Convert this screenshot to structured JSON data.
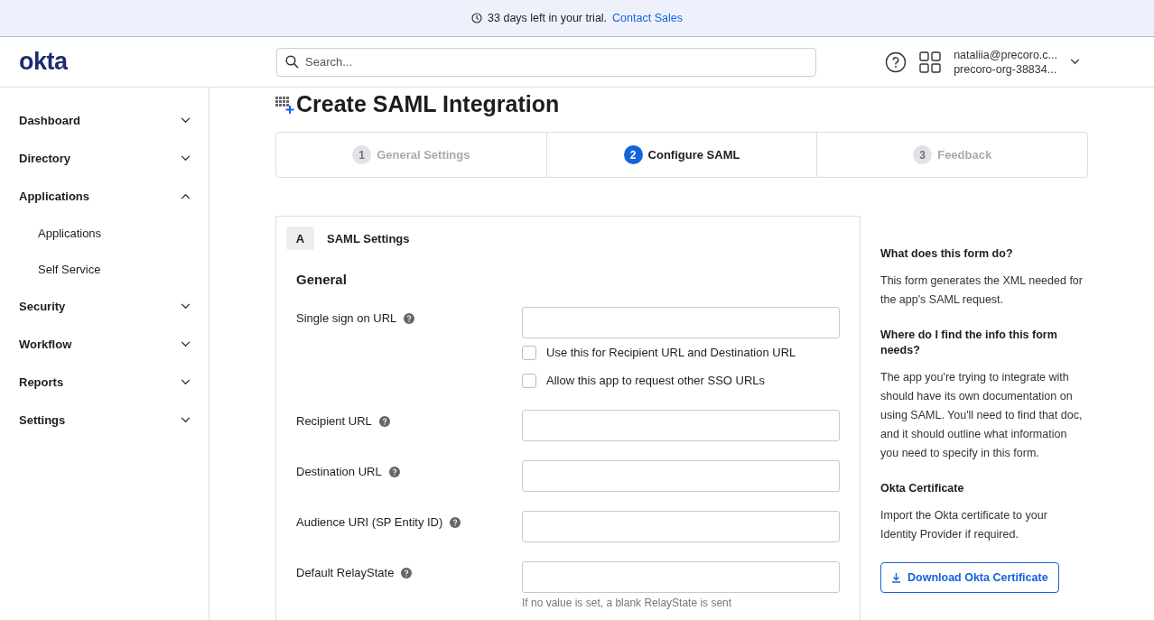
{
  "banner": {
    "text": "33 days left in your trial.",
    "link": "Contact Sales"
  },
  "header": {
    "logo": "okta",
    "search": {
      "placeholder": "Search..."
    },
    "user": {
      "email": "nataliia@precoro.c...",
      "org": "precoro-org-38834..."
    }
  },
  "sidebar": {
    "items": [
      {
        "label": "Dashboard",
        "expanded": false
      },
      {
        "label": "Directory",
        "expanded": false
      },
      {
        "label": "Applications",
        "expanded": true,
        "children": [
          {
            "label": "Applications"
          },
          {
            "label": "Self Service"
          }
        ]
      },
      {
        "label": "Security",
        "expanded": false
      },
      {
        "label": "Workflow",
        "expanded": false
      },
      {
        "label": "Reports",
        "expanded": false
      },
      {
        "label": "Settings",
        "expanded": false
      }
    ]
  },
  "page": {
    "title": "Create SAML Integration"
  },
  "steps": [
    {
      "number": "1",
      "label": "General Settings",
      "selected": false
    },
    {
      "number": "2",
      "label": "Configure SAML",
      "selected": true
    },
    {
      "number": "3",
      "label": "Feedback",
      "selected": false
    }
  ],
  "section": {
    "badge": "A",
    "title": "SAML Settings",
    "group": "General",
    "fields": [
      {
        "label": "Single sign on URL",
        "checkboxes": [
          {
            "label": "Use this for Recipient URL and Destination URL",
            "checked": false
          },
          {
            "label": "Allow this app to request other SSO URLs",
            "checked": false
          }
        ]
      },
      {
        "label": "Recipient URL"
      },
      {
        "label": "Destination URL"
      },
      {
        "label": "Audience URI (SP Entity ID)"
      },
      {
        "label": "Default RelayState",
        "hint": "If no value is set, a blank RelayState is sent"
      }
    ]
  },
  "help": {
    "blocks": [
      {
        "heading": "What does this form do?",
        "text": "This form generates the XML needed for the app's SAML request."
      },
      {
        "heading": "Where do I find the info this form needs?",
        "text": "The app you're trying to integrate with should have its own documentation on using SAML. You'll need to find that doc, and it should outline what information you need to specify in this form."
      },
      {
        "heading": "Okta Certificate",
        "text": "Import the Okta certificate to your Identity Provider if required."
      }
    ],
    "button": "Download Okta Certificate"
  }
}
